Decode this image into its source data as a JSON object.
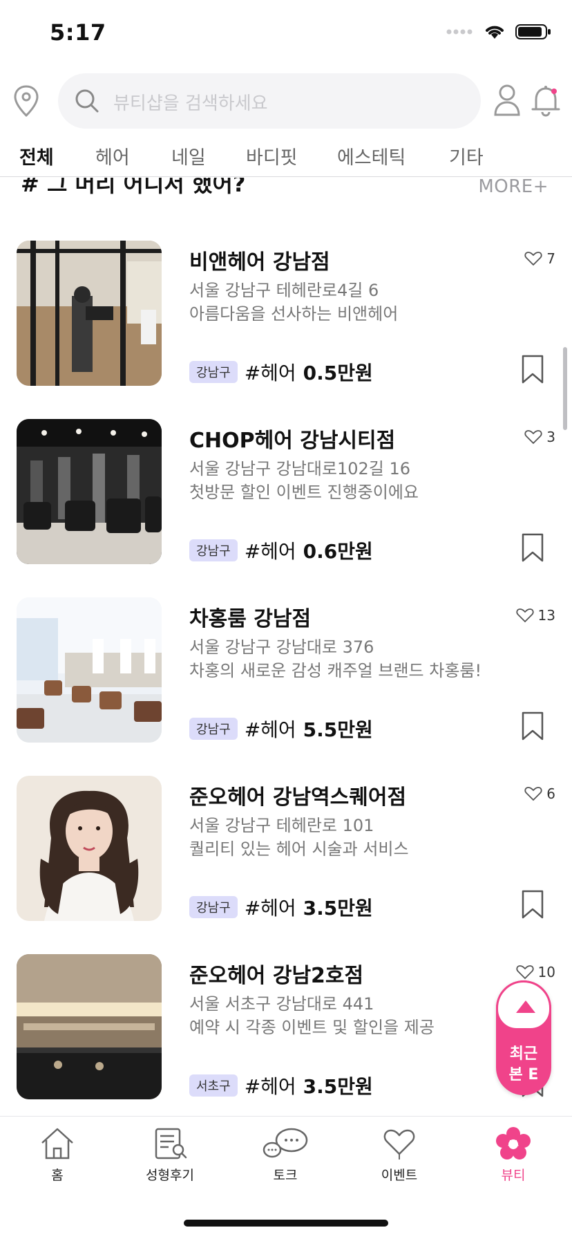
{
  "status": {
    "time": "5:17"
  },
  "search": {
    "placeholder": "뷰티샵을 검색하세요"
  },
  "tabs": [
    {
      "label": "전체",
      "active": true
    },
    {
      "label": "헤어"
    },
    {
      "label": "네일"
    },
    {
      "label": "바디핏"
    },
    {
      "label": "에스테틱"
    },
    {
      "label": "기타"
    }
  ],
  "section": {
    "title": "# 그 머리 어디서 했어?",
    "more": "MORE+"
  },
  "shops": [
    {
      "name": "비앤헤어 강남점",
      "address": "서울 강남구 테헤란로4길 6",
      "description": "아름다움을 선사하는 비앤헤어",
      "likes": "7",
      "region": "강남구",
      "category": "#헤어",
      "price": "0.5만원"
    },
    {
      "name": "CHOP헤어 강남시티점",
      "address": "서울 강남구 강남대로102길 16",
      "description": "첫방문 할인 이벤트 진행중이에요",
      "likes": "3",
      "region": "강남구",
      "category": "#헤어",
      "price": "0.6만원"
    },
    {
      "name": "차홍룸 강남점",
      "address": "서울 강남구 강남대로 376",
      "description": "차홍의 새로운 감성 캐주얼 브랜드 차홍룸!",
      "likes": "13",
      "region": "강남구",
      "category": "#헤어",
      "price": "5.5만원"
    },
    {
      "name": "준오헤어 강남역스퀘어점",
      "address": "서울 강남구 테헤란로 101",
      "description": "퀄리티 있는 헤어 시술과 서비스",
      "likes": "6",
      "region": "강남구",
      "category": "#헤어",
      "price": "3.5만원"
    },
    {
      "name": "준오헤어 강남2호점",
      "address": "서울 서초구 강남대로 441",
      "description": "예약 시  각종 이벤트 및 할인을 제공",
      "likes": "10",
      "region": "서초구",
      "category": "#헤어",
      "price": "3.5만원"
    }
  ],
  "floating": {
    "label_line1": "최근",
    "label_line2": "본 E"
  },
  "nav": [
    {
      "label": "홈",
      "icon": "home-icon"
    },
    {
      "label": "성형후기",
      "icon": "review-icon"
    },
    {
      "label": "토크",
      "icon": "chat-icon"
    },
    {
      "label": "이벤트",
      "icon": "event-heart-icon"
    },
    {
      "label": "뷰티",
      "icon": "flower-icon",
      "active": true
    }
  ],
  "colors": {
    "accent": "#f0438a",
    "badge_bg": "#dcdcfa"
  }
}
